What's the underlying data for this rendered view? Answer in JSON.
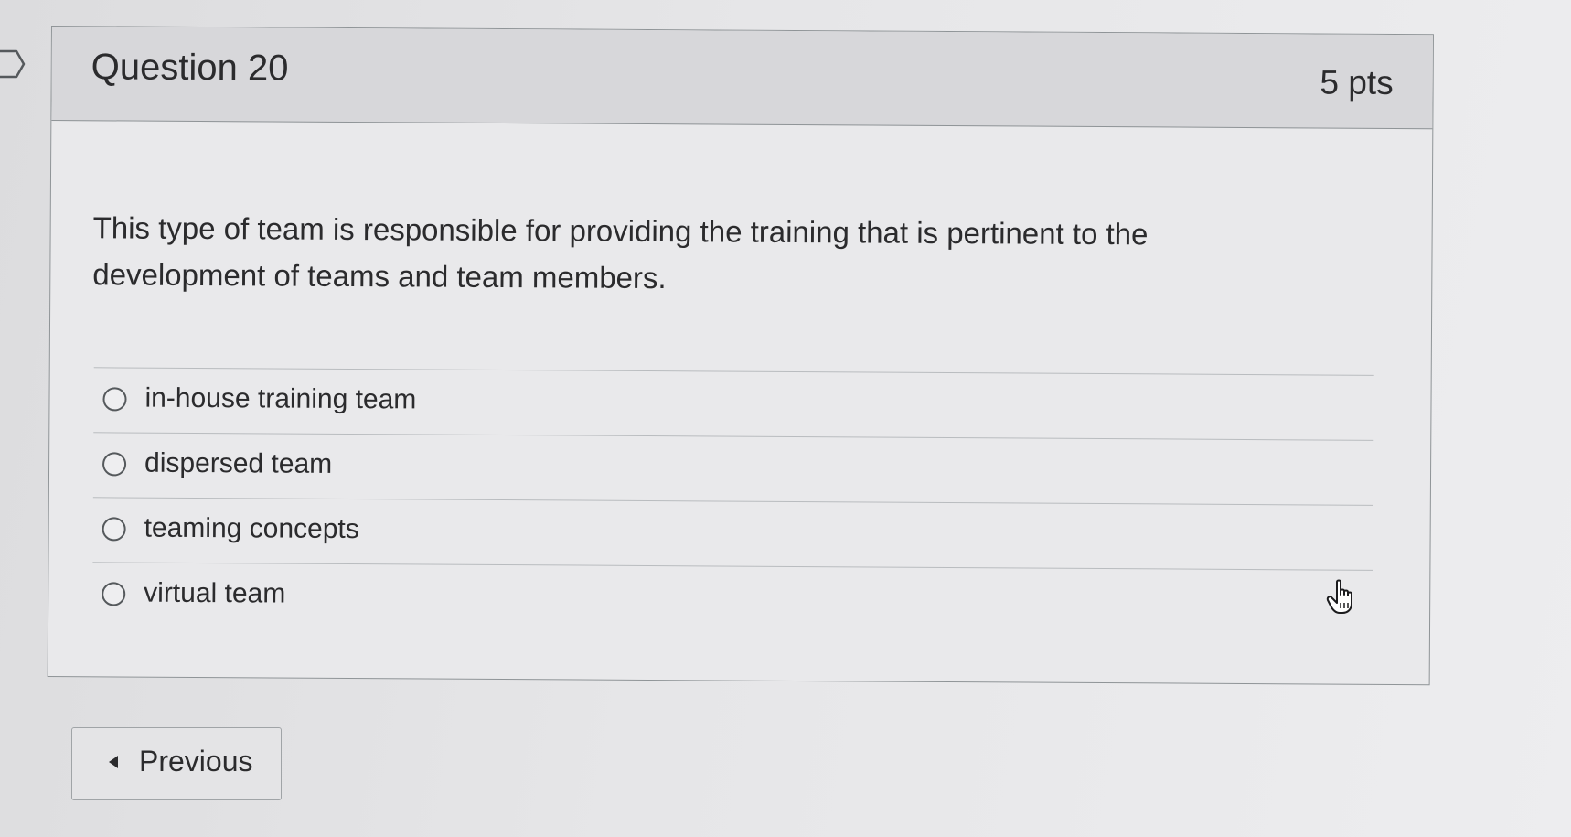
{
  "question": {
    "title": "Question 20",
    "points": "5 pts",
    "text": "This type of team is responsible for providing the training that is pertinent to the development of teams and team members."
  },
  "answers": [
    {
      "label": "in-house training team",
      "selected": false
    },
    {
      "label": "dispersed team",
      "selected": false
    },
    {
      "label": "teaming concepts",
      "selected": false
    },
    {
      "label": "virtual team",
      "selected": false
    }
  ],
  "navigation": {
    "previous_label": "Previous"
  },
  "icons": {
    "flag": "flag-marker-icon",
    "cursor": "hand-pointer-icon",
    "previous": "caret-left-icon"
  }
}
